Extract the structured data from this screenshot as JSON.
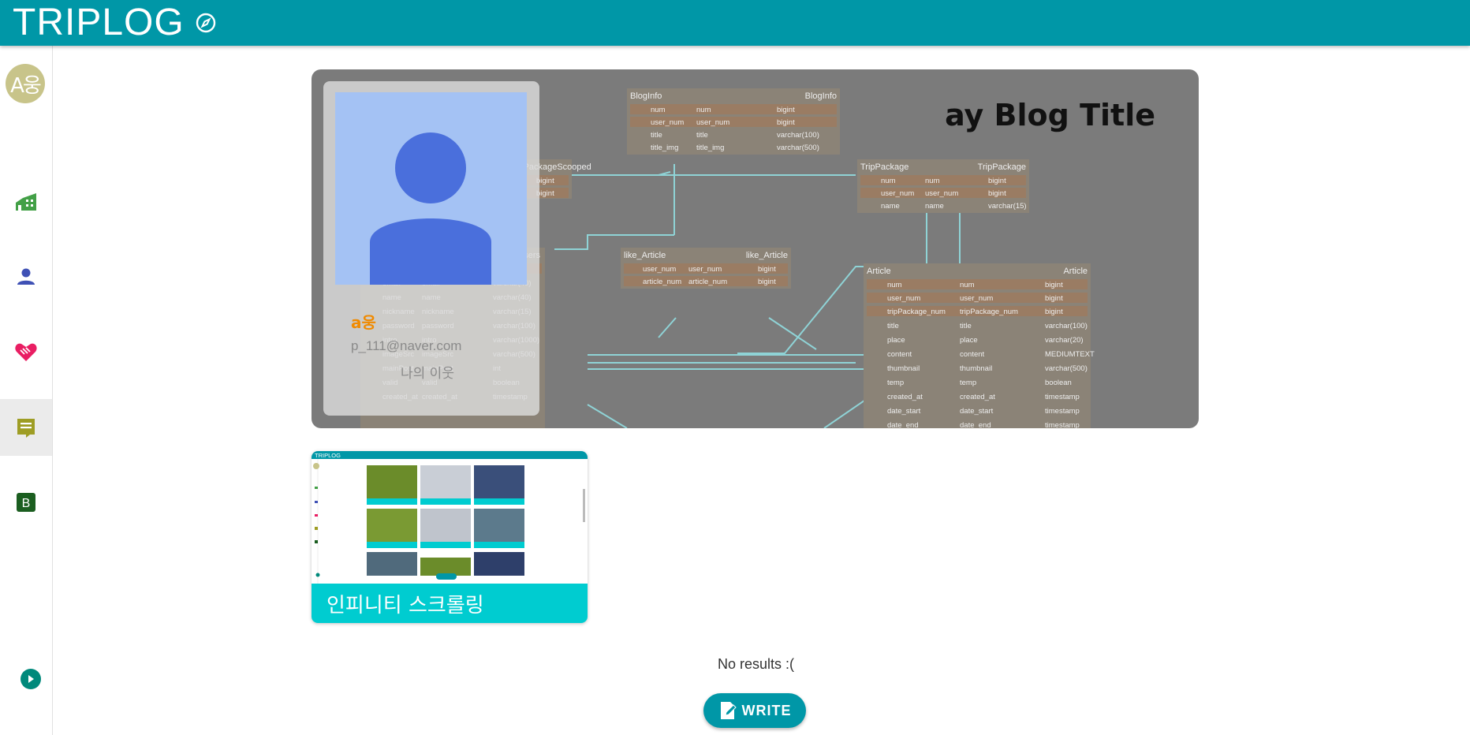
{
  "header": {
    "title": "TRIPLOG",
    "icon": "compass-icon"
  },
  "sidebar": {
    "avatar_text": "A웅",
    "items": [
      {
        "name": "home",
        "icon": "home-icon",
        "color": "#43a047"
      },
      {
        "name": "profile",
        "icon": "person-icon",
        "color": "#3f51b5"
      },
      {
        "name": "likes",
        "icon": "heart-hand-icon",
        "color": "#e91e63"
      },
      {
        "name": "blog",
        "icon": "article-icon",
        "color": "#9e9d24",
        "active": true
      },
      {
        "name": "board",
        "icon": "b-badge-icon",
        "color": "#1b5e20",
        "label": "B"
      }
    ],
    "collapse_icon": "chevron-right-circle-icon"
  },
  "banner": {
    "blog_title": "ay Blog Title",
    "profile": {
      "name": "a웅",
      "email": "p_111@naver.com",
      "neighbor": "나의 이웃"
    },
    "erd": {
      "tables": [
        {
          "name": "BlogInfo",
          "rows": [
            [
              "num",
              "num",
              "bigint"
            ],
            [
              "user_num",
              "user_num",
              "bigint"
            ],
            [
              "title",
              "title",
              "varchar(100)"
            ],
            [
              "title_img",
              "title_img",
              "varchar(500)"
            ]
          ]
        },
        {
          "name": "TripPackage",
          "rows": [
            [
              "num",
              "num",
              "bigint"
            ],
            [
              "user_num",
              "user_num",
              "bigint"
            ],
            [
              "name",
              "name",
              "varchar(15)"
            ]
          ]
        },
        {
          "name": "like_Article",
          "rows": [
            [
              "user_num",
              "user_num",
              "bigint"
            ],
            [
              "article_num",
              "article_num",
              "bigint"
            ]
          ]
        },
        {
          "name": "users",
          "rows": [
            [
              "num",
              "num",
              "bigint"
            ],
            [
              "email",
              "email",
              "varchar(40)"
            ],
            [
              "name",
              "name",
              "varchar(40)"
            ],
            [
              "nickname",
              "nickname",
              "varchar(15)"
            ],
            [
              "password",
              "password",
              "varchar(100)"
            ],
            [
              "intro",
              "intro",
              "varchar(1000)"
            ],
            [
              "imageSrc",
              "imageSrc",
              "varchar(500)"
            ],
            [
              "mainPost",
              "mainPost",
              "int"
            ],
            [
              "valid",
              "valid",
              "boolean"
            ],
            [
              "created_at",
              "created_at",
              "timestamp"
            ]
          ]
        },
        {
          "name": "Article",
          "rows": [
            [
              "num",
              "num",
              "bigint"
            ],
            [
              "user_num",
              "user_num",
              "bigint"
            ],
            [
              "tripPackage_num",
              "tripPackage_num",
              "bigint"
            ],
            [
              "title",
              "title",
              "varchar(100)"
            ],
            [
              "place",
              "place",
              "varchar(20)"
            ],
            [
              "content",
              "content",
              "MEDIUMTEXT"
            ],
            [
              "thumbnail",
              "thumbnail",
              "varchar(500)"
            ],
            [
              "temp",
              "temp",
              "boolean"
            ],
            [
              "created_at",
              "created_at",
              "timestamp"
            ],
            [
              "date_start",
              "date_start",
              "timestamp"
            ],
            [
              "date_end",
              "date_end",
              "timestamp"
            ]
          ]
        },
        {
          "name": "TripPackageScooped",
          "rows": [
            [
              "",
              "",
              "bigint"
            ],
            [
              "",
              "",
              "bigint"
            ]
          ]
        }
      ]
    }
  },
  "posts": [
    {
      "title": "인피니티 스크롤링",
      "thumb_header": "TRIPLOG"
    }
  ],
  "no_results": "No results :(",
  "write_button": "WRITE"
}
